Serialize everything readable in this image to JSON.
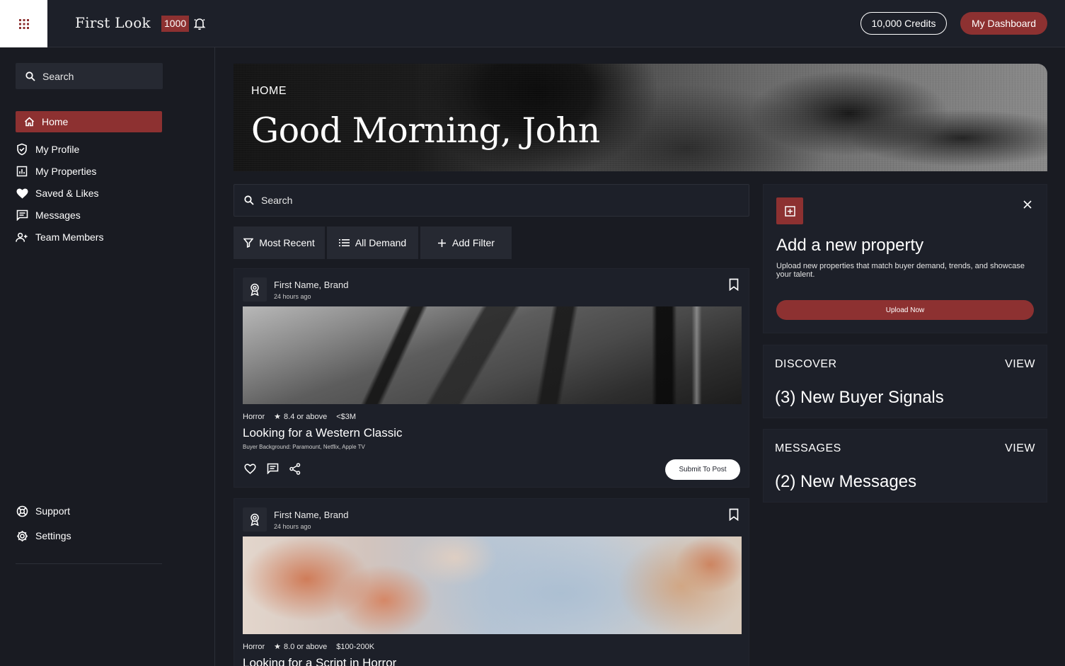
{
  "topbar": {
    "brand": "First Look",
    "counter": "1000",
    "credits_label": "10,000 Credits",
    "dashboard_label": "My Dashboard",
    "icons": {
      "apps": "grid-icon",
      "notifications": "bell-icon"
    }
  },
  "sidebar": {
    "search_placeholder": "Search",
    "nav": [
      {
        "label": "Home",
        "icon": "home-icon",
        "active": true
      },
      {
        "label": "My Profile",
        "icon": "shield-check-icon"
      },
      {
        "label": "My Properties",
        "icon": "chart-box-icon"
      },
      {
        "label": "Saved & Likes",
        "icon": "heart-icon"
      },
      {
        "label": "Messages",
        "icon": "message-icon"
      },
      {
        "label": "Team Members",
        "icon": "add-user-icon"
      }
    ],
    "footer_nav": [
      {
        "label": "Support",
        "icon": "lifebuoy-icon"
      },
      {
        "label": "Settings",
        "icon": "gear-icon"
      }
    ]
  },
  "hero": {
    "eyebrow": "HOME",
    "greeting": "Good Morning, John"
  },
  "feed": {
    "search_placeholder": "Search",
    "filters": [
      {
        "label": "Most Recent",
        "icon": "funnel-icon"
      },
      {
        "label": "All Demand",
        "icon": "list-icon"
      },
      {
        "label": "Add Filter",
        "icon": "plus-icon"
      }
    ],
    "posts": [
      {
        "author": "First Name, Brand",
        "posted": "24 hours ago",
        "genre": "Horror",
        "rating": "8.4 or above",
        "budget": "<$3M",
        "title": "Looking for a Western Classic",
        "subtitle": "Buyer Background: Paramount, Netflix, Apple TV",
        "submit_label": "Submit To Post"
      },
      {
        "author": "First Name, Brand",
        "posted": "24 hours ago",
        "genre": "Horror",
        "rating": "8.0 or above",
        "budget": "$100-200K",
        "title": "Looking for a Script in Horror"
      }
    ]
  },
  "promo": {
    "title": "Add a new property",
    "text": "Upload new properties that match buyer demand, trends, and showcase your talent.",
    "button_label": "Upload Now"
  },
  "stats": [
    {
      "label": "DISCOVER",
      "view_label": "VIEW",
      "value": "(3) New Buyer Signals"
    },
    {
      "label": "MESSAGES",
      "view_label": "VIEW",
      "value": "(2) New Messages"
    }
  ],
  "colors": {
    "background": "#191b22",
    "panel": "#1d2029",
    "accent": "#8d3131",
    "text": "#ffffff"
  }
}
